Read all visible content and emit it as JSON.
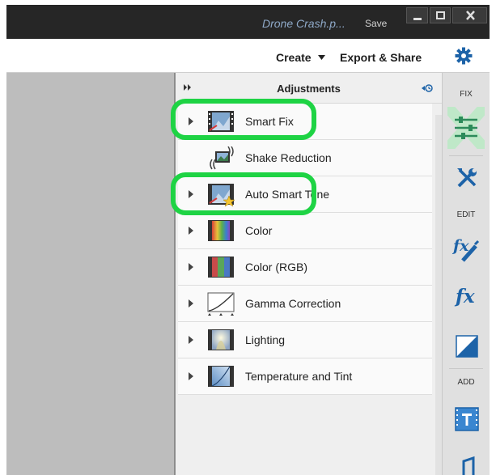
{
  "window": {
    "document_title": "Drone Crash.p...",
    "save_label": "Save"
  },
  "menu": {
    "create_label": "Create",
    "export_label": "Export & Share"
  },
  "panel": {
    "title": "Adjustments",
    "items": [
      {
        "label": "Smart Fix"
      },
      {
        "label": "Shake Reduction"
      },
      {
        "label": "Auto Smart Tone"
      },
      {
        "label": "Color"
      },
      {
        "label": "Color (RGB)"
      },
      {
        "label": "Gamma Correction"
      },
      {
        "label": "Lighting"
      },
      {
        "label": "Temperature and Tint"
      }
    ]
  },
  "toolbar": {
    "fix_label": "FIX",
    "edit_label": "EDIT",
    "add_label": "ADD",
    "icons": [
      "adjustments-sliders-icon",
      "tools-icon",
      "fx-brush-icon",
      "fx-icon",
      "gradient-icon",
      "text-icon",
      "music-icon"
    ]
  },
  "colors": {
    "highlight": "#1ed344",
    "title_bar": "#262626",
    "accent_blue": "#1d63a8"
  }
}
